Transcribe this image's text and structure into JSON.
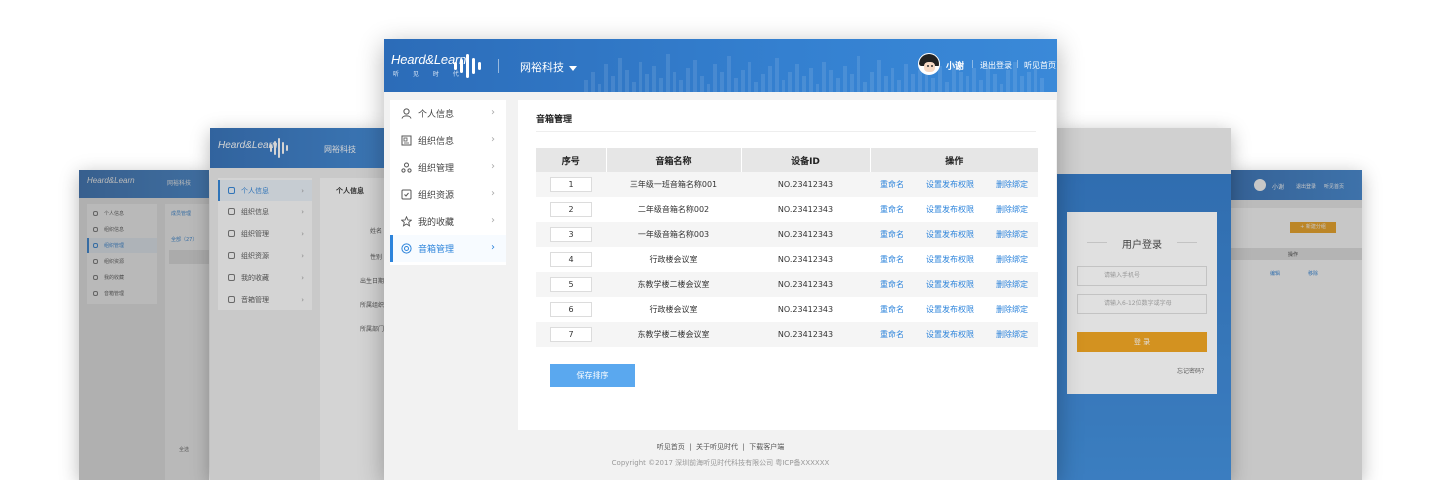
{
  "brand": {
    "logo": "Heard&Learn",
    "tagline": "听 见 时 代"
  },
  "org": {
    "name": "网裕科技"
  },
  "user": {
    "name": "小谢"
  },
  "top_nav": {
    "logout": "退出登录",
    "home": "听见首页"
  },
  "sidebar": {
    "items": [
      {
        "label": "个人信息",
        "icon": "user-icon"
      },
      {
        "label": "组织信息",
        "icon": "id-card-icon"
      },
      {
        "label": "组织管理",
        "icon": "org-chart-icon"
      },
      {
        "label": "组织资源",
        "icon": "resource-icon"
      },
      {
        "label": "我的收藏",
        "icon": "star-icon"
      },
      {
        "label": "音箱管理",
        "icon": "speaker-icon"
      }
    ],
    "active_index": 5
  },
  "main": {
    "title": "音箱管理",
    "table": {
      "headers": [
        "序号",
        "音箱名称",
        "设备ID",
        "操作"
      ],
      "actions": [
        "重命名",
        "设置发布权限",
        "删除绑定"
      ],
      "rows": [
        {
          "seq": "1",
          "name": "三年级一班音箱名称001",
          "device_id": "NO.23412343"
        },
        {
          "seq": "2",
          "name": "二年级音箱名称002",
          "device_id": "NO.23412343"
        },
        {
          "seq": "3",
          "name": "一年级音箱名称003",
          "device_id": "NO.23412343"
        },
        {
          "seq": "4",
          "name": "行政楼会议室",
          "device_id": "NO.23412343"
        },
        {
          "seq": "5",
          "name": "东教学楼二楼会议室",
          "device_id": "NO.23412343"
        },
        {
          "seq": "6",
          "name": "行政楼会议室",
          "device_id": "NO.23412343"
        },
        {
          "seq": "7",
          "name": "东教学楼二楼会议室",
          "device_id": "NO.23412343"
        }
      ]
    },
    "save_button": "保存排序"
  },
  "footer": {
    "links": [
      "听见首页",
      "关于听见时代",
      "下载客户端"
    ],
    "separator": "|",
    "copyright": "Copyright ©2017 深圳前海听见时代科技有限公司 粤ICP备XXXXXX"
  },
  "bg_profile": {
    "title": "个人信息",
    "fields": [
      "姓名",
      "性别",
      "出生日期",
      "所属组织",
      "所属部门"
    ]
  },
  "bg_list": {
    "tab": "成员管理",
    "count_label": "全部（27）",
    "footer_checkbox": "全选"
  },
  "bg_right": {
    "user": "小谢",
    "logout": "退出登录",
    "home": "听见首页",
    "add_button": "+ 新建分组",
    "ops_header": "操作",
    "row_actions": [
      "编辑",
      "移除"
    ]
  },
  "login": {
    "title": "用户登录",
    "phone_placeholder": "请输入手机号",
    "password_placeholder": "请输入6-12位数字或字母",
    "submit": "登 录",
    "forgot": "忘记密码？"
  },
  "colors": {
    "primary": "#3480d0",
    "accent": "#2d84db",
    "save": "#5aa8ef",
    "login": "#f0a21b"
  }
}
